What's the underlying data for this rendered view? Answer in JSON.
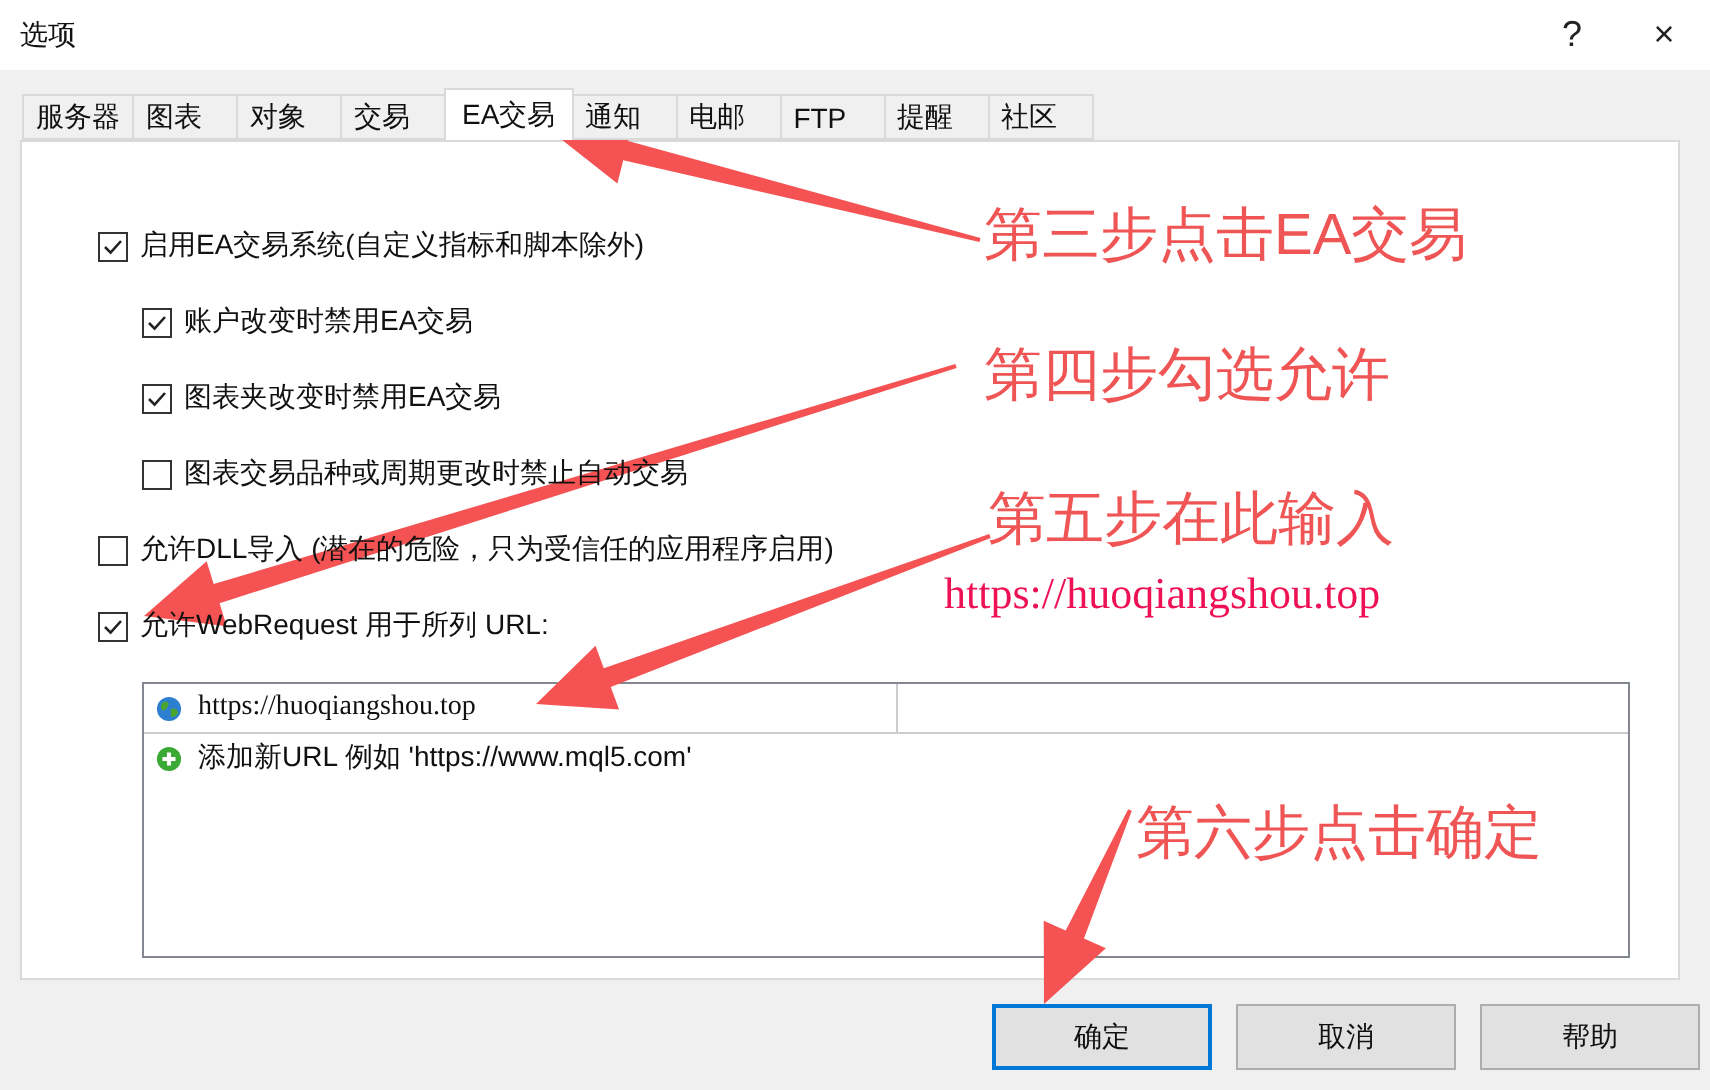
{
  "window": {
    "title": "选项",
    "help": "?",
    "close": "×"
  },
  "tabs": [
    {
      "label": "服务器",
      "selected": false
    },
    {
      "label": "图表",
      "selected": false
    },
    {
      "label": "对象",
      "selected": false
    },
    {
      "label": "交易",
      "selected": false
    },
    {
      "label": "EA交易",
      "selected": true
    },
    {
      "label": "通知",
      "selected": false
    },
    {
      "label": "电邮",
      "selected": false
    },
    {
      "label": "FTP",
      "selected": false
    },
    {
      "label": "提醒",
      "selected": false
    },
    {
      "label": "社区",
      "selected": false
    }
  ],
  "options": [
    {
      "label": "启用EA交易系统(自定义指标和脚本除外)",
      "checked": true,
      "children": [
        {
          "label": "账户改变时禁用EA交易",
          "checked": true
        },
        {
          "label": "图表夹改变时禁用EA交易",
          "checked": true
        },
        {
          "label": "图表交易品种或周期更改时禁止自动交易",
          "checked": false
        }
      ]
    },
    {
      "label": "允许DLL导入 (潜在的危险，只为受信任的应用程序启用)",
      "checked": false
    },
    {
      "label": "允许WebRequest 用于所列 URL:",
      "checked": true
    }
  ],
  "url_list": [
    {
      "kind": "url",
      "text": "https://huoqiangshou.top"
    },
    {
      "kind": "add",
      "text": "添加新URL 例如 'https://www.mql5.com'"
    }
  ],
  "buttons": [
    {
      "label": "确定",
      "focused": true
    },
    {
      "label": "取消",
      "focused": false
    },
    {
      "label": "帮助",
      "focused": false
    }
  ],
  "annotations": [
    {
      "kind": "step",
      "text": "第三步点击EA交易"
    },
    {
      "kind": "step",
      "text": "第四步勾选允许"
    },
    {
      "kind": "step",
      "text": "第五步在此输入"
    },
    {
      "kind": "url",
      "text": "https://huoqiangshou.top"
    },
    {
      "kind": "step",
      "text": "第六步点击确定"
    }
  ]
}
